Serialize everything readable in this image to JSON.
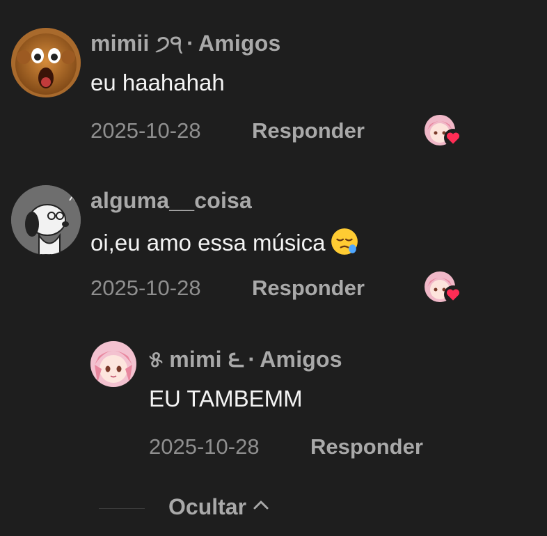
{
  "comments": [
    {
      "username": "mimii ੭੧",
      "tag": "Amigos",
      "text": "eu haahahah",
      "date": "2025-10-28",
      "reply_label": "Responder",
      "avatar_icon": "surprised-monkey-avatar"
    },
    {
      "username": "alguma__coisa",
      "tag": "",
      "text": "oi,eu amo essa música",
      "emoji": "sleepy-face-emoji",
      "date": "2025-10-28",
      "reply_label": "Responder",
      "avatar_icon": "snoopy-avatar"
    },
    {
      "username": "୫ mimi ౬",
      "tag": "Amigos",
      "text": "EU TAMBEMM",
      "date": "2025-10-28",
      "reply_label": "Responder",
      "avatar_icon": "pink-anime-girl-avatar"
    }
  ],
  "separator": "·",
  "hide_label": "Ocultar",
  "colors": {
    "background": "#1e1e1e",
    "username": "#a9a9a9",
    "text": "#f4f4f4",
    "meta": "#8f8f8f",
    "heart": "#ff2d55"
  }
}
